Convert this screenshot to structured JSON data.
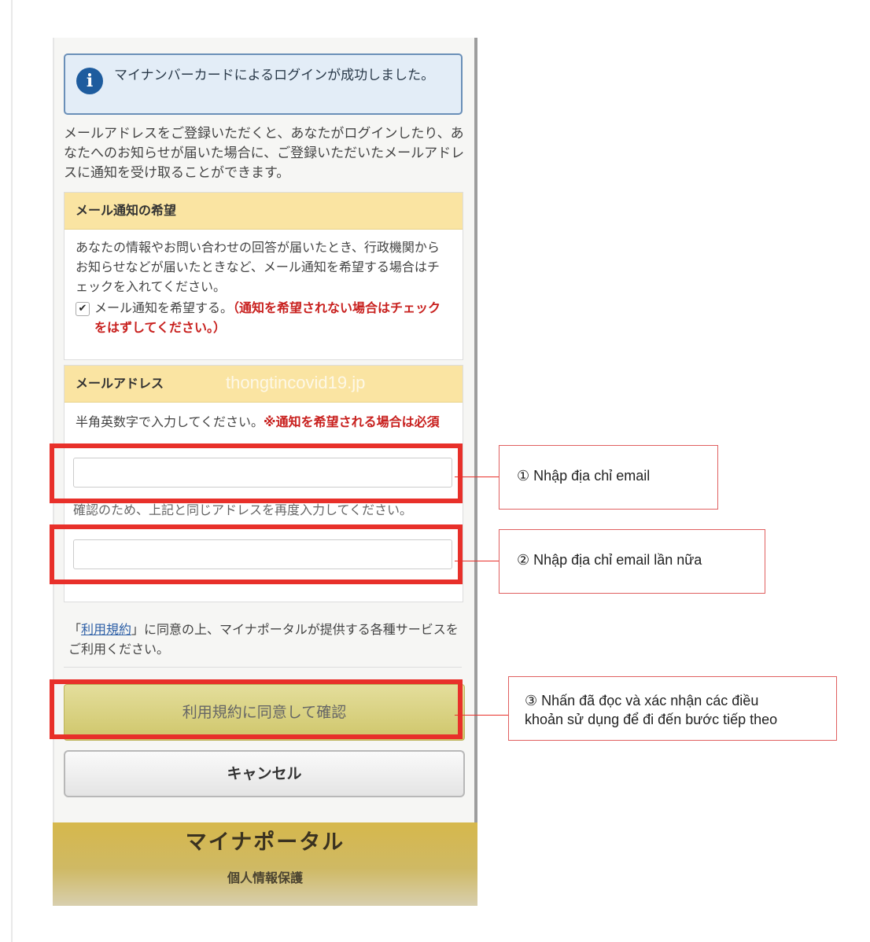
{
  "info_message": "マイナンバーカードによるログインが成功しました。",
  "intro_text": "メールアドレスをご登録いただくと、あなたがログインしたり、あなたへのお知らせが届いた場合に、ご登録いただいたメールアドレスに通知を受け取ることができます。",
  "mail_notice": {
    "heading": "メール通知の希望",
    "description": "あなたの情報やお問い合わせの回答が届いたとき、行政機関からお知らせなどが届いたときなど、メール通知を希望する場合はチェックを入れてください。",
    "checkbox_label": "メール通知を希望する。",
    "checkbox_note": "（通知を希望されない場合はチェックをはずしてください。）",
    "checked": true
  },
  "email_section": {
    "heading": "メールアドレス",
    "hint": "半角英数字で入力してください。",
    "required_note": "※通知を希望される場合は必須",
    "email_value": "",
    "confirm_hint": "確認のため、上記と同じアドレスを再度入力してください。",
    "confirm_value": ""
  },
  "watermark": "thongtincovid19.jp",
  "terms": {
    "open_bracket": "「",
    "link": "利用規約",
    "rest": "」に同意の上、マイナポータルが提供する各種サービスをご利用ください。"
  },
  "buttons": {
    "agree": "利用規約に同意して確認",
    "cancel": "キャンセル"
  },
  "footer": {
    "brand": "マイナポータル",
    "privacy": "個人情報保護"
  },
  "callouts": {
    "c1": "① Nhập địa chỉ email",
    "c2": "② Nhập địa chỉ email lần nữa",
    "c3_line1": "③ Nhấn đã đọc và xác nhận các điều",
    "c3_line2": "khoản sử dụng để đi đến bước tiếp theo"
  },
  "colors": {
    "highlight": "#e8302a",
    "section_header": "#fae4a2",
    "info_border": "#6a8fb8",
    "agree_button": "#cfc66a",
    "footer_band": "#d6b84c"
  }
}
